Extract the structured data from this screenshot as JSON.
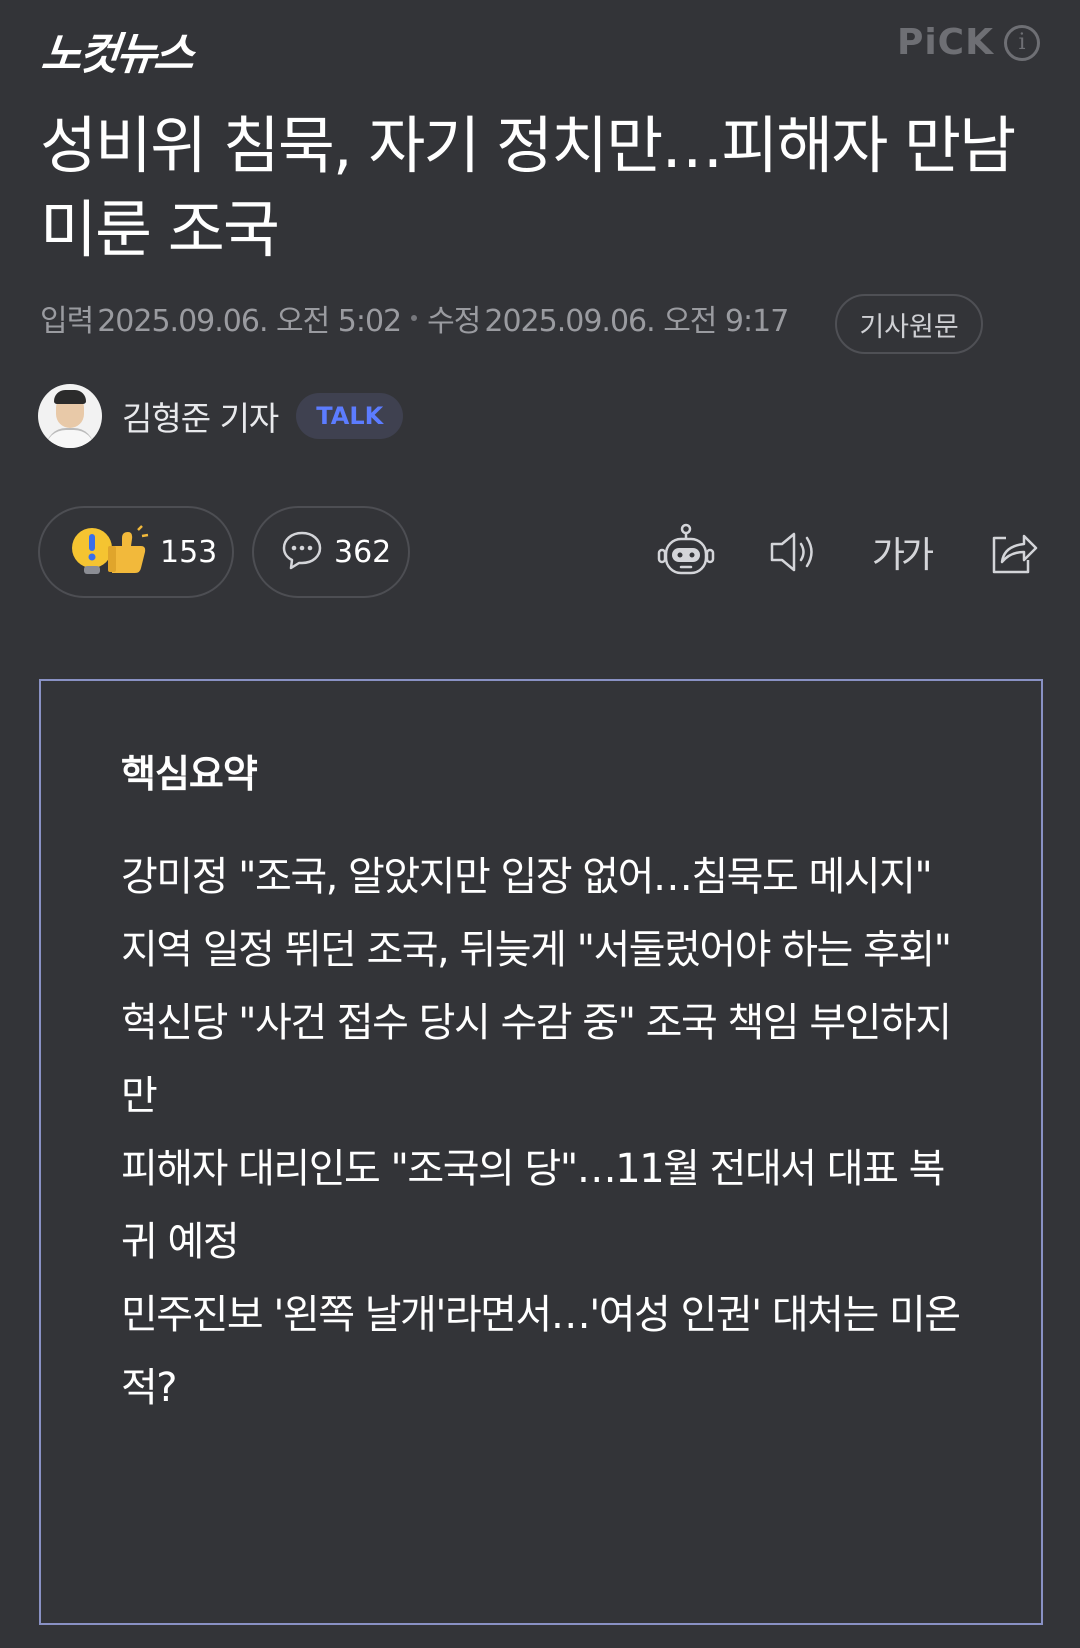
{
  "header": {
    "logo_text": "노컷뉴스",
    "pick_label": "PiCK",
    "info_glyph": "i"
  },
  "article": {
    "headline": "성비위 침묵, 자기 정치만…피해자 만남 미룬 조국",
    "input_label": "입력",
    "input_time": "2025.09.06. 오전 5:02",
    "edit_label": "수정",
    "edit_time": "2025.09.06. 오전 9:17",
    "original_button": "기사원문",
    "author": "김형준 기자",
    "talk_label": "TALK"
  },
  "actions": {
    "reaction_count": "153",
    "comment_count": "362",
    "font_size_label": "가가",
    "icons": [
      "reaction-icon",
      "comment-icon",
      "summary-bot-icon",
      "speaker-icon",
      "font-size-icon",
      "share-icon"
    ]
  },
  "summary": {
    "title": "핵심요약",
    "items": [
      "강미정 \"조국, 알았지만 입장 없어…침묵도 메시지\"",
      "지역 일정 뛰던 조국, 뒤늦게 \"서둘렀어야 하는 후회\"",
      "혁신당 \"사건 접수 당시 수감 중\" 조국 책임 부인하지만",
      "피해자 대리인도 \"조국의 당\"…11월 전대서 대표 복귀 예정",
      "민주진보 '왼쪽 날개'라면서…'여성 인권' 대처는 미온적?"
    ]
  },
  "colors": {
    "background": "#333438",
    "summary_border": "#8991c4",
    "talk_text": "#5c7cff",
    "muted_text": "#9a9ba0"
  }
}
